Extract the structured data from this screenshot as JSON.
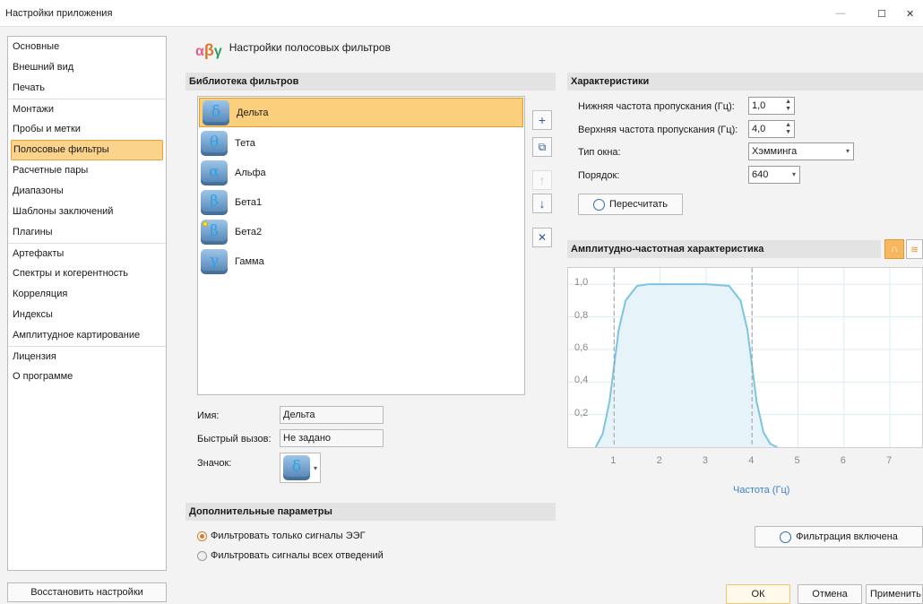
{
  "window": {
    "title": "Настройки приложения",
    "minimize_glyph": "—",
    "maximize_glyph": "☐",
    "close_glyph": "✕"
  },
  "sidebar": {
    "items": [
      {
        "label": "Основные"
      },
      {
        "label": "Внешний вид"
      },
      {
        "label": "Печать"
      },
      {
        "label": "Монтажи"
      },
      {
        "label": "Пробы и метки"
      },
      {
        "label": "Полосовые фильтры"
      },
      {
        "label": "Расчетные пары"
      },
      {
        "label": "Диапазоны"
      },
      {
        "label": "Шаблоны заключений"
      },
      {
        "label": "Плагины"
      },
      {
        "label": "Артефакты"
      },
      {
        "label": "Спектры и когерентность"
      },
      {
        "label": "Корреляция"
      },
      {
        "label": "Индексы"
      },
      {
        "label": "Амплитудное картирование"
      },
      {
        "label": "Лицензия"
      },
      {
        "label": "О программе"
      }
    ],
    "selected": "Полосовые фильтры",
    "restore_button": "Восстановить настройки"
  },
  "header": {
    "logo": {
      "alpha": "α",
      "beta": "β",
      "gamma": "γ"
    },
    "title": "Настройки полосовых фильтров"
  },
  "library": {
    "heading": "Библиотека фильтров",
    "items": [
      {
        "symbol": "δ",
        "label": "Дельта"
      },
      {
        "symbol": "θ",
        "label": "Тета"
      },
      {
        "symbol": "α",
        "label": "Альфа"
      },
      {
        "symbol": "β",
        "label": "Бета1"
      },
      {
        "symbol": "β",
        "label": "Бета2"
      },
      {
        "symbol": "γ",
        "label": "Гамма"
      }
    ],
    "selected": "Дельта",
    "tools": {
      "add": "+",
      "copy": "⧉",
      "up": "↑",
      "down": "↓",
      "delete": "✕"
    }
  },
  "details": {
    "name_label": "Имя:",
    "name_value": "Дельта",
    "hotkey_label": "Быстрый вызов:",
    "hotkey_value": "Не задано",
    "icon_label": "Значок:",
    "icon_symbol": "δ",
    "icon_caret": "▾"
  },
  "extra": {
    "heading": "Дополнительные параметры",
    "options": [
      {
        "label": "Фильтровать только сигналы ЭЭГ",
        "selected": true
      },
      {
        "label": "Фильтровать сигналы всех отведений",
        "selected": false
      }
    ]
  },
  "characteristics": {
    "heading": "Характеристики",
    "low_label": "Нижняя частота пропускания (Гц):",
    "low_value": "1,0",
    "high_label": "Верхняя частота пропускания (Гц):",
    "high_value": "4,0",
    "window_label": "Тип окна:",
    "window_value": "Хэмминга",
    "order_label": "Порядок:",
    "order_value": "640",
    "spin_up": "▲",
    "spin_down": "▼",
    "caret": "▾",
    "recalc_button": "Пересчитать"
  },
  "afc": {
    "heading": "Амплитудно-частотная характеристика",
    "filter_toggle": "Фильтрация включена"
  },
  "chart_data": {
    "type": "line",
    "xlabel": "Частота (Гц)",
    "ylabel": "",
    "xlim": [
      0,
      7.7
    ],
    "ylim": [
      0,
      1.1
    ],
    "xticks": [
      "1",
      "2",
      "3",
      "4",
      "5",
      "6",
      "7"
    ],
    "yticks": [
      "0,2",
      "0,4",
      "0,6",
      "0,8",
      "1,0"
    ],
    "markers_x": [
      1,
      4
    ],
    "grid": true,
    "series": [
      {
        "x": [
          0.6,
          0.75,
          0.9,
          1.0,
          1.1,
          1.25,
          1.5,
          1.75,
          2.0,
          2.5,
          3.0,
          3.5,
          3.75,
          3.9,
          4.0,
          4.1,
          4.25,
          4.4,
          4.55
        ],
        "y": [
          0.0,
          0.08,
          0.28,
          0.5,
          0.72,
          0.9,
          0.99,
          1.0,
          1.0,
          1.0,
          1.0,
          0.99,
          0.9,
          0.72,
          0.5,
          0.28,
          0.09,
          0.02,
          0.0
        ]
      }
    ],
    "colors": {
      "line": "#7cc4e0",
      "fill": "#e6f4fa",
      "marker": "#9a9a9a",
      "grid": "#dcecf5"
    }
  },
  "footer": {
    "ok": "ОК",
    "cancel": "Отмена",
    "apply": "Применить"
  }
}
